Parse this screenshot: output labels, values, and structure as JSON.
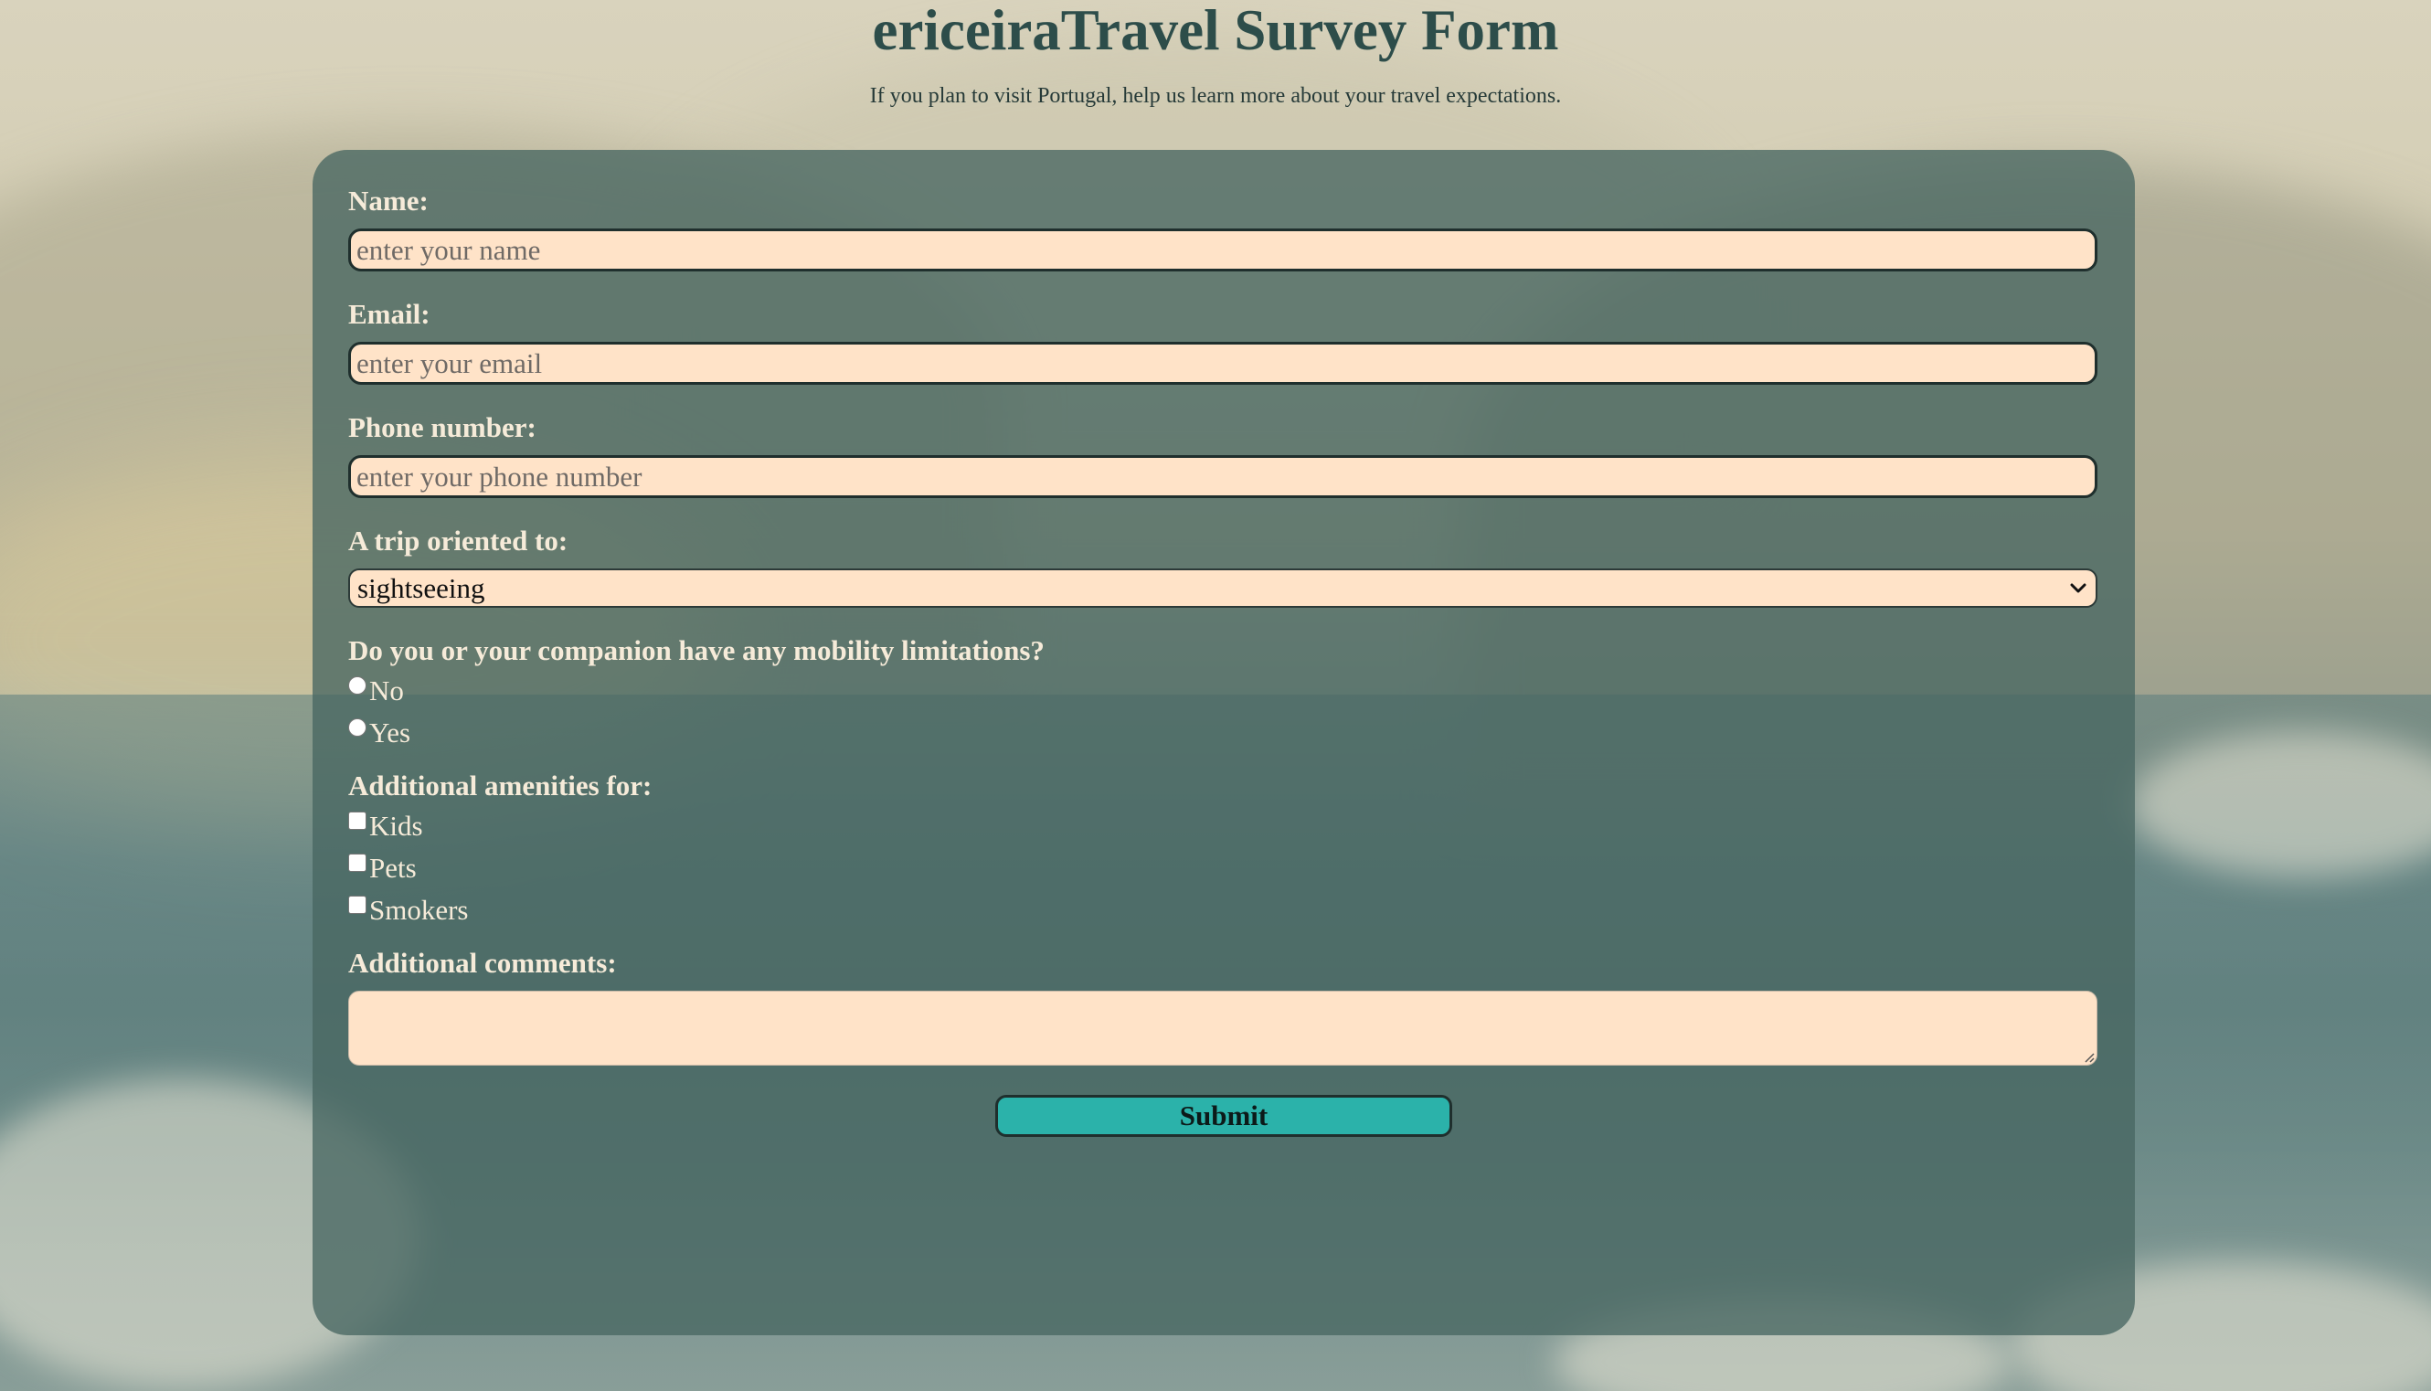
{
  "header": {
    "title": "ericeiraTravel Survey Form",
    "subtitle": "If you plan to visit Portugal, help us learn more about your travel expectations."
  },
  "form": {
    "name": {
      "label": "Name:",
      "placeholder": "enter your name",
      "value": ""
    },
    "email": {
      "label": "Email:",
      "placeholder": "enter your email",
      "value": ""
    },
    "phone": {
      "label": "Phone number:",
      "placeholder": "enter your phone number",
      "value": ""
    },
    "trip": {
      "label": "A trip oriented to:",
      "selected": "sightseeing",
      "icon": "chevron-down-icon"
    },
    "mobility": {
      "question": "Do you or your companion have any mobility limitations?",
      "options": [
        {
          "label": "No",
          "checked": false
        },
        {
          "label": "Yes",
          "checked": false
        }
      ]
    },
    "amenities": {
      "label": "Additional amenities for:",
      "options": [
        {
          "label": "Kids",
          "checked": false
        },
        {
          "label": "Pets",
          "checked": false
        },
        {
          "label": "Smokers",
          "checked": false
        }
      ]
    },
    "comments": {
      "label": "Additional comments:",
      "value": ""
    },
    "submit_label": "Submit"
  },
  "colors": {
    "title": "#2d4d4a",
    "card_bg": "#486661",
    "input_bg": "#ffe3c8",
    "submit_bg": "#2bb2aa",
    "label_text": "#f6ebd9"
  }
}
